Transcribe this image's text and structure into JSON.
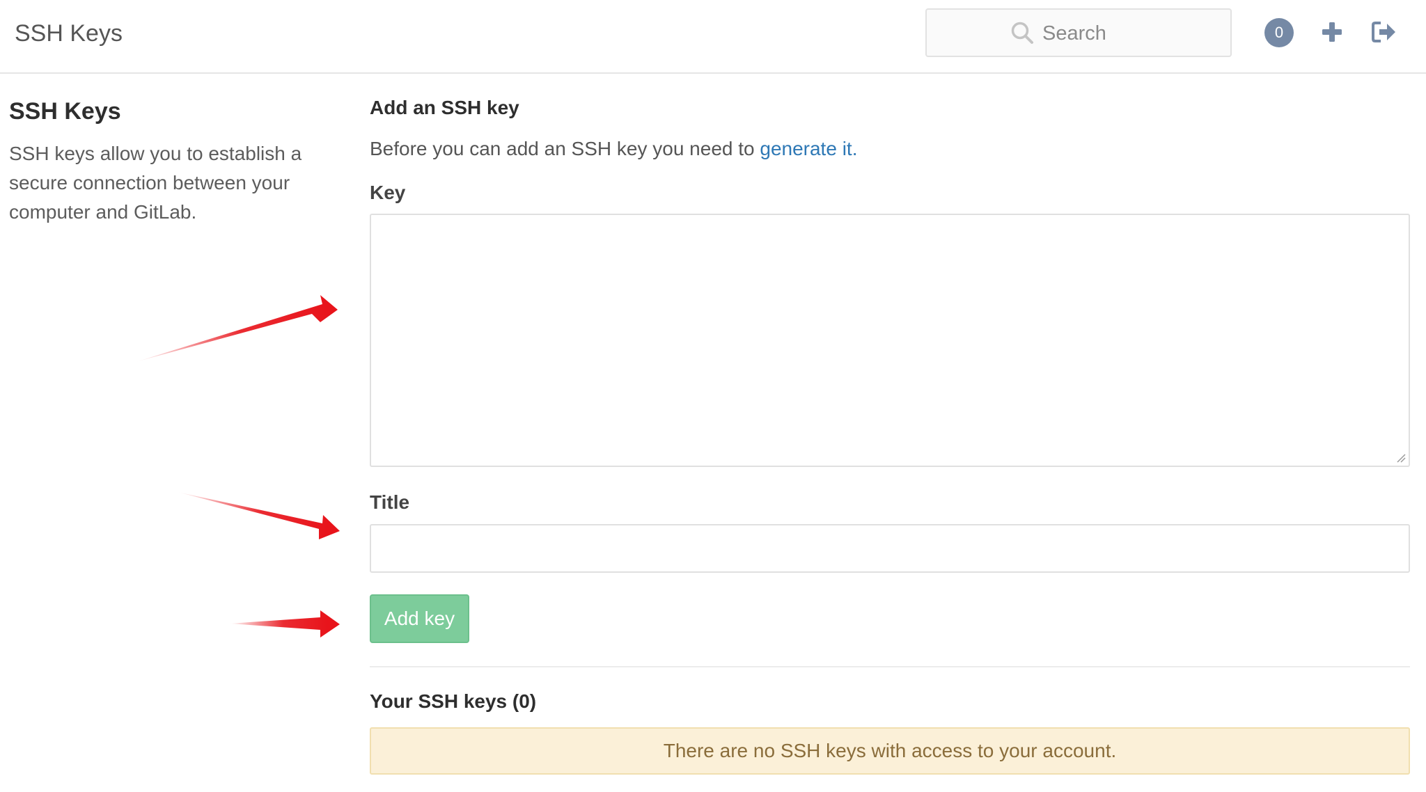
{
  "header": {
    "title": "SSH Keys",
    "search_placeholder": "Search",
    "todo_count": "0",
    "icons": [
      "search-icon",
      "plus-icon",
      "sign-out-icon"
    ]
  },
  "sidebar": {
    "heading": "SSH Keys",
    "description": "SSH keys allow you to establish a secure connection between your computer and GitLab."
  },
  "form": {
    "heading": "Add an SSH key",
    "intro_text": "Before you can add an SSH key you need to ",
    "intro_link": "generate it.",
    "key_label": "Key",
    "key_value": "",
    "title_label": "Title",
    "title_value": "",
    "submit_label": "Add key"
  },
  "keys_list": {
    "heading": "Your SSH keys (0)",
    "empty_message": "There are no SSH keys with access to your account."
  },
  "colors": {
    "link": "#2e78b5",
    "button": "#7dcc9b",
    "alert_bg": "#fbf0d8",
    "alert_text": "#8a6d3b",
    "badge": "#7589a5",
    "annotation_arrow": "#e8141b"
  }
}
